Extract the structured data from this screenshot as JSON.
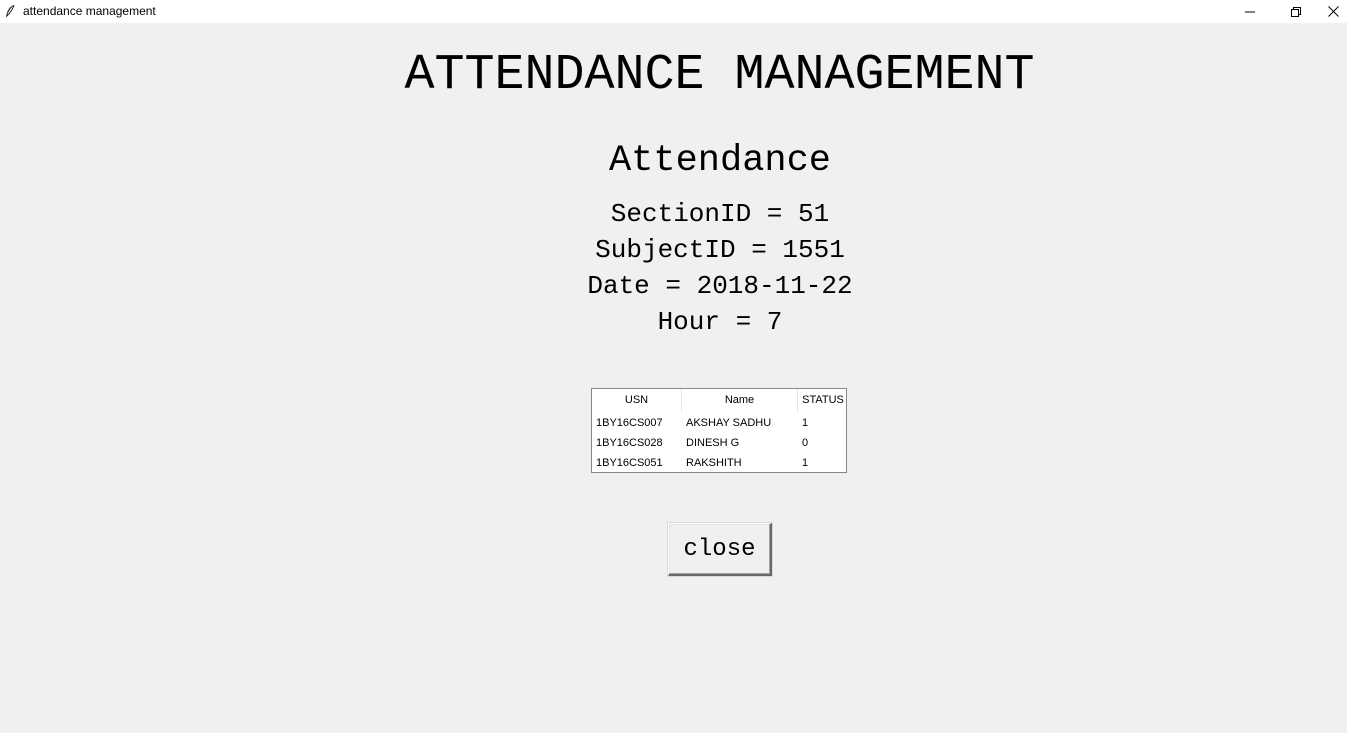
{
  "window": {
    "title": "attendance management",
    "icons": {
      "app": "feather-icon",
      "minimize": "minimize-icon",
      "maximize": "restore-icon",
      "close": "close-icon"
    }
  },
  "heading": "ATTENDANCE MANAGEMENT",
  "subheading": "Attendance",
  "info": {
    "section": "SectionID = 51",
    "subject": "SubjectID = 1551",
    "date": "Date = 2018-11-22",
    "hour": "Hour = 7"
  },
  "table": {
    "columns": [
      "USN",
      "Name",
      "STATUS"
    ],
    "rows": [
      [
        "1BY16CS007",
        "AKSHAY SADHU",
        "1"
      ],
      [
        "1BY16CS028",
        "DINESH G",
        "0"
      ],
      [
        "1BY16CS051",
        "RAKSHITH",
        "1"
      ]
    ]
  },
  "close_button": "close"
}
